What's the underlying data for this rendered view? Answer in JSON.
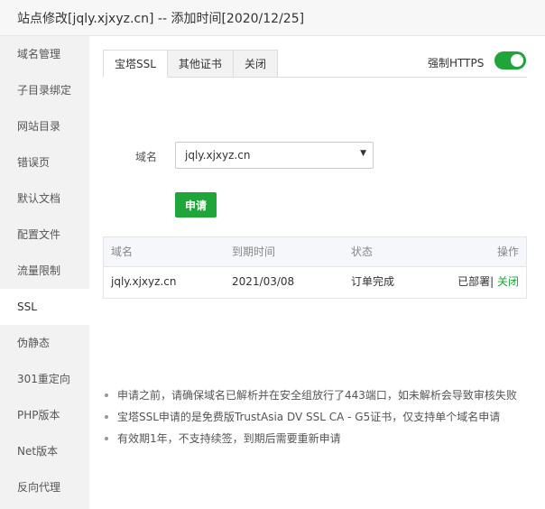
{
  "window": {
    "title": "站点修改[jqly.xjxyz.cn] -- 添加时间[2020/12/25]"
  },
  "sidebar": {
    "items": [
      {
        "label": "域名管理"
      },
      {
        "label": "子目录绑定"
      },
      {
        "label": "网站目录"
      },
      {
        "label": "错误页"
      },
      {
        "label": "默认文档"
      },
      {
        "label": "配置文件"
      },
      {
        "label": "流量限制"
      },
      {
        "label": "SSL"
      },
      {
        "label": "伪静态"
      },
      {
        "label": "301重定向"
      },
      {
        "label": "PHP版本"
      },
      {
        "label": "Net版本"
      },
      {
        "label": "反向代理"
      }
    ],
    "active": "SSL"
  },
  "tabs": [
    {
      "label": "宝塔SSL"
    },
    {
      "label": "其他证书"
    },
    {
      "label": "关闭"
    }
  ],
  "force_https": {
    "label": "强制HTTPS",
    "enabled": true
  },
  "form": {
    "domain_label": "域名",
    "domain_value": "jqly.xjxyz.cn",
    "caret": "▼",
    "apply_label": "申请"
  },
  "table": {
    "headers": [
      "域名",
      "到期时间",
      "状态",
      "操作"
    ],
    "rows": [
      {
        "domain": "jqly.xjxyz.cn",
        "expiry": "2021/03/08",
        "status": "订单完成",
        "deployed": "已部署",
        "separator": "|",
        "close": " 关闭"
      }
    ]
  },
  "notes": [
    "申请之前，请确保域名已解析并在安全组放行了443端口，如未解析会导致审核失败",
    "宝塔SSL申请的是免费版TrustAsia DV SSL CA - G5证书，仅支持单个域名申请",
    "有效期1年，不支持续签，到期后需要重新申请"
  ],
  "colors": {
    "accent": "#20a53a"
  }
}
